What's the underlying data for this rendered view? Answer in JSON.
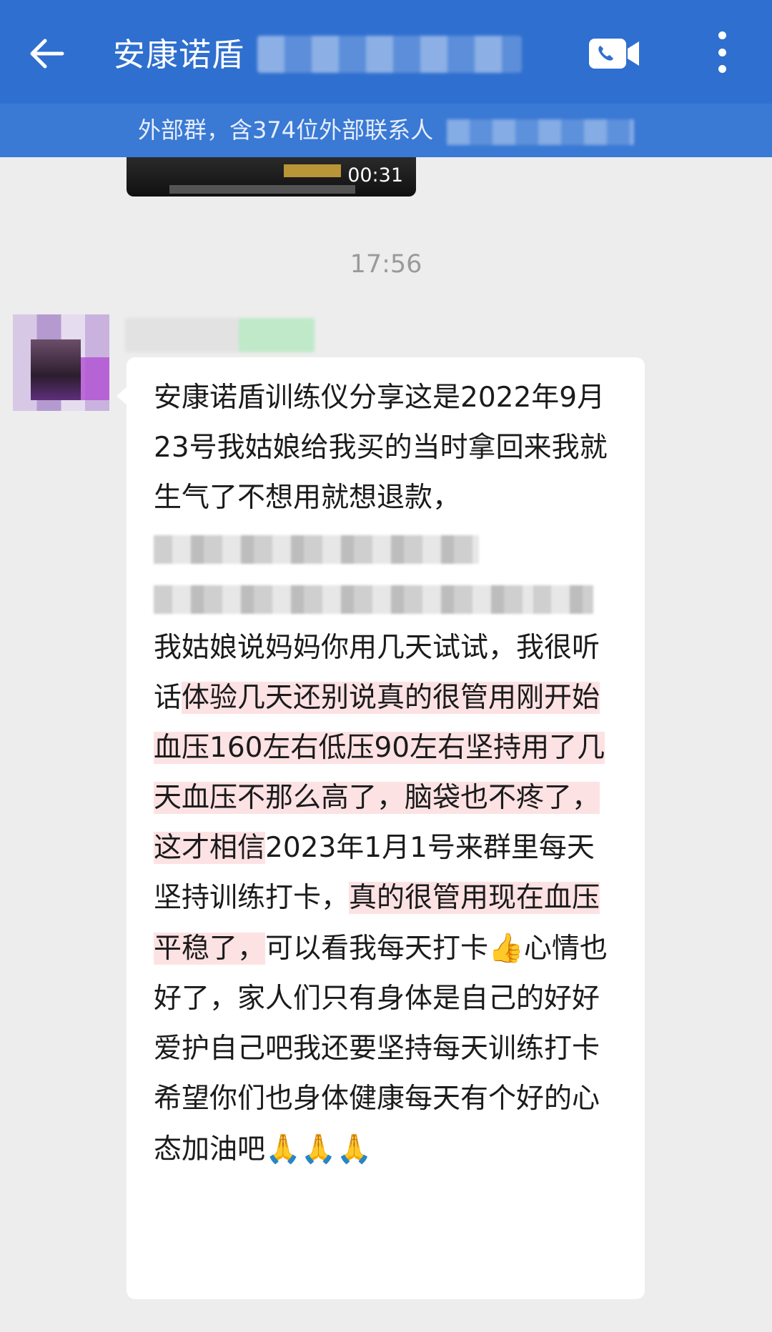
{
  "header": {
    "title": "安康诺盾",
    "subtitle": "外部群，含374位外部联系人"
  },
  "video": {
    "duration": "00:31"
  },
  "chat": {
    "timestamp": "17:56",
    "message": {
      "segments": [
        {
          "text": "安康诺盾训练仪分享这是2022年9月23号我姑娘给我买的当时拿回来我就生气了不想用就想退款，",
          "highlight": false
        },
        {
          "text": "我姑娘说妈妈你用几天试试，我很听话",
          "highlight": false
        },
        {
          "text": "体验几天还别说真的很管用刚开始血压160左右低压90左右坚持用了几天血压不那么高了，脑袋也不疼了，这才相信",
          "highlight": true
        },
        {
          "text": "2023年1月1号来群里每天坚持训练打卡，",
          "highlight": false
        },
        {
          "text": "真的很管用现在血压平稳了，",
          "highlight": true
        },
        {
          "text": "可以看我每天打卡",
          "highlight": false
        },
        {
          "text": "心情也好了，家人们只有身体是自己的好好爱护自己吧我还要坚持每天训练打卡希望你们也身体健康每天有个好的心态加油吧",
          "highlight": false
        }
      ],
      "emojis": {
        "thumbs_up": "👍",
        "pray": "🙏"
      }
    }
  },
  "icons": {
    "back": "back-arrow-icon",
    "call": "video-call-icon",
    "more": "more-vertical-icon"
  },
  "colors": {
    "header_bg": "#2f6fcf",
    "subheader_bg": "#3a79d4",
    "highlight": "#fde2e4",
    "chat_bg": "#ededed"
  }
}
